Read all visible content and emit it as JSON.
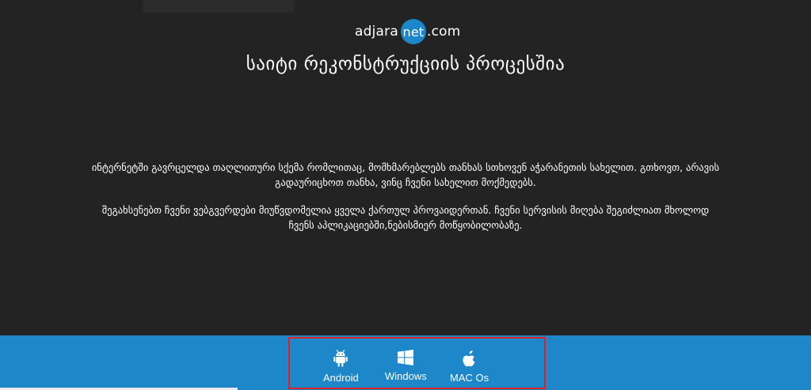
{
  "logo": {
    "prefix": "adjara",
    "badge": "net",
    "suffix": ".com"
  },
  "title": "საიტი რეკონსტრუქციის პროცესშია",
  "description": {
    "paragraph1": "ინტერნეტში გავრცელდა თაღლითური სქემა რომლითაც, მომხმარებლებს თანხას სთხოვენ აჭარანეთის სახელით. გთხოვთ, არავის გადაურიცხოთ თანხა, ვინც ჩვენი სახელით მოქმედებს.",
    "paragraph2": "შეგახსენებთ ჩვენი ვებგვერდები მიუწვდომელია ყველა ქართულ პროვაიდერთან. ჩვენი სერვისის მიღება შეგიძლიათ მხოლოდ ჩვენს აპლიკაციებში,ნებისმიერ მოწყობილობაზე."
  },
  "apps": {
    "android": {
      "label": "Android",
      "icon": "android-icon"
    },
    "windows": {
      "label": "Windows",
      "icon": "windows-icon"
    },
    "mac": {
      "label": "MAC Os",
      "icon": "apple-icon"
    }
  },
  "colors": {
    "background": "#232323",
    "footer": "#1e87c9",
    "accent": "#1b86c8",
    "highlight_border": "#e01f26",
    "text": "#ffffff"
  }
}
